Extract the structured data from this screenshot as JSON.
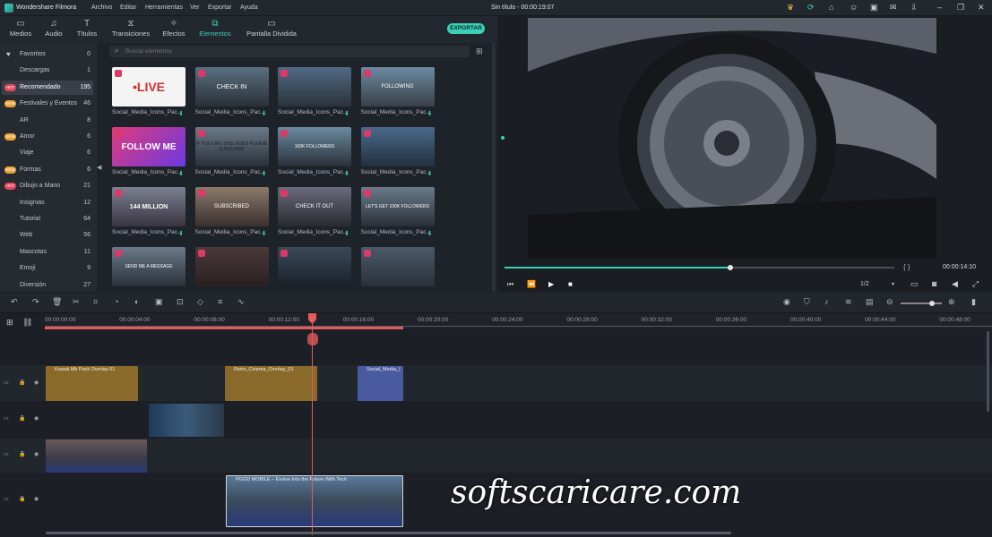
{
  "window": {
    "app_name": "Wondershare Filmora",
    "menu": [
      "Archivo",
      "Editar",
      "Herramientas",
      "Ver",
      "Exportar",
      "Ayuda"
    ],
    "project_title": "Sin título - 00:00:19:07"
  },
  "toptabs": [
    {
      "label": "Medios",
      "icon": "folder-icon"
    },
    {
      "label": "Audio",
      "icon": "music-icon"
    },
    {
      "label": "Títulos",
      "icon": "text-icon"
    },
    {
      "label": "Transiciones",
      "icon": "transition-icon"
    },
    {
      "label": "Efectos",
      "icon": "effects-icon"
    },
    {
      "label": "Elementos",
      "icon": "elements-icon"
    },
    {
      "label": "Pantalla Dividida",
      "icon": "split-screen-icon"
    }
  ],
  "export_label": "EXPORTAR",
  "search": {
    "placeholder": "Buscar elementos"
  },
  "sidebar": {
    "items": [
      {
        "label": "Favoritos",
        "count": "0",
        "badge": ""
      },
      {
        "label": "Descargas",
        "count": "1",
        "badge": ""
      },
      {
        "label": "Recomendado",
        "count": "195",
        "badge": "HOT"
      },
      {
        "label": "Festivales y Eventos",
        "count": "46",
        "badge": "NEW"
      },
      {
        "label": "AR",
        "count": "8",
        "badge": ""
      },
      {
        "label": "Amor",
        "count": "6",
        "badge": "NEW"
      },
      {
        "label": "Viaje",
        "count": "6",
        "badge": ""
      },
      {
        "label": "Formas",
        "count": "6",
        "badge": "NEW"
      },
      {
        "label": "Dibujo a Mano",
        "count": "21",
        "badge": "HOT"
      },
      {
        "label": "Insignias",
        "count": "12",
        "badge": ""
      },
      {
        "label": "Tutorial",
        "count": "64",
        "badge": ""
      },
      {
        "label": "Web",
        "count": "56",
        "badge": ""
      },
      {
        "label": "Mascotas",
        "count": "11",
        "badge": ""
      },
      {
        "label": "Emoji",
        "count": "9",
        "badge": ""
      },
      {
        "label": "Diversión",
        "count": "27",
        "badge": ""
      }
    ]
  },
  "grid": {
    "items": [
      {
        "caption": "Social_Media_Icons_Pac...",
        "art": "•LIVE"
      },
      {
        "caption": "Social_Media_Icons_Pac...",
        "art": "CHECK IN"
      },
      {
        "caption": "Social_Media_Icons_Pac...",
        "art": ""
      },
      {
        "caption": "Social_Media_Icons_Pac...",
        "art": "FOLLOWING"
      },
      {
        "caption": "Social_Media_Icons_Pac...",
        "art": "FOLLOW ME"
      },
      {
        "caption": "Social_Media_Icons_Pac...",
        "art": "IF YOU LIKE THIS VIDEO PLEASE SUBSCRIBE"
      },
      {
        "caption": "Social_Media_Icons_Pac...",
        "art": "100K FOLLOWERS"
      },
      {
        "caption": "Social_Media_Icons_Pac...",
        "art": ""
      },
      {
        "caption": "Social_Media_Icons_Pac...",
        "art": "144 MILLION"
      },
      {
        "caption": "Social_Media_Icons_Pac...",
        "art": "SUBSCRIBED"
      },
      {
        "caption": "Social_Media_Icons_Pac...",
        "art": "CHECK IT OUT"
      },
      {
        "caption": "Social_Media_Icons_Pac...",
        "art": "LET'S GET 100K FOLLOWERS"
      },
      {
        "caption": "",
        "art": "SEND ME A MESSAGE"
      },
      {
        "caption": "",
        "art": ""
      },
      {
        "caption": "",
        "art": ""
      },
      {
        "caption": "",
        "art": ""
      }
    ]
  },
  "player": {
    "timecode": "00:00:14:10",
    "ratio": "1/2",
    "brackets": "{     }",
    "progress": 0.58
  },
  "ruler": [
    "00:00:00:00",
    "00:00:04:00",
    "00:00:08:00",
    "00:00:12:00",
    "00:00:16:00",
    "00:00:20:00",
    "00:00:24:00",
    "00:00:28:00",
    "00:00:32:00",
    "00:00:36:00",
    "00:00:40:00",
    "00:00:44:00",
    "00:00:48:00"
  ],
  "clips": {
    "t1a": "Kawaii Mb Pack Overlay 01",
    "t1b": "Retro_Cinema_Overlay_01",
    "t1c": "Social_Media_I",
    "t4": "PGGD MOBILE – Evolve Into the Future With Tech"
  },
  "watermark": "softscaricare.com",
  "colors": {
    "accent": "#3ad1b8",
    "playhead": "#e55a5a",
    "overlay_clip": "#8a6a2a",
    "element_clip": "#4a5aa0"
  }
}
